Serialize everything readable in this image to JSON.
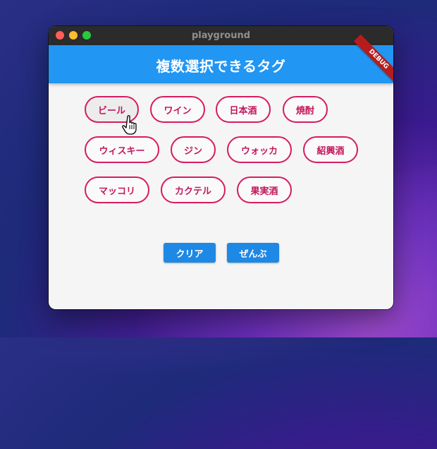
{
  "window": {
    "title": "playground"
  },
  "appbar": {
    "title": "複数選択できるタグ",
    "debug_label": "DEBUG"
  },
  "tags": [
    {
      "label": "ビール",
      "hovered": true
    },
    {
      "label": "ワイン"
    },
    {
      "label": "日本酒"
    },
    {
      "label": "焼酎"
    },
    {
      "label": "ウィスキー"
    },
    {
      "label": "ジン"
    },
    {
      "label": "ウォッカ"
    },
    {
      "label": "紹興酒"
    },
    {
      "label": "マッコリ"
    },
    {
      "label": "カクテル"
    },
    {
      "label": "果実酒"
    }
  ],
  "actions": {
    "clear_label": "クリア",
    "all_label": "ぜんぶ"
  },
  "colors": {
    "appbar": "#2196f3",
    "chip_border": "#d81b60",
    "chip_text": "#c2185b",
    "button": "#1e88e5"
  },
  "icons": {
    "cursor": "hand-pointer-icon"
  }
}
